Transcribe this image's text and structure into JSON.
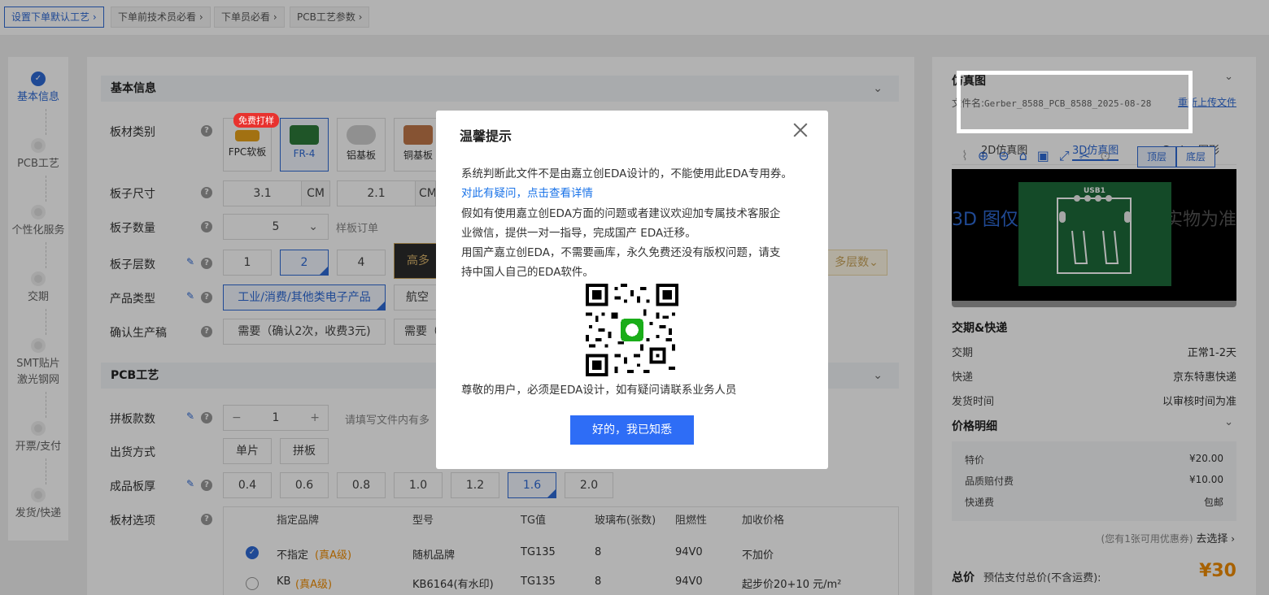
{
  "breadcrumb": [
    "设置下单默认工艺",
    "下单前技术员必看",
    "下单员必看",
    "PCB工艺参数"
  ],
  "steps": [
    "基本信息",
    "PCB工艺",
    "个性化服务",
    "交期",
    "SMT贴片激光钢网",
    "开票/支付",
    "发货/快递"
  ],
  "basic": {
    "title": "基本信息",
    "board_type_label": "板材类别",
    "free_badge": "免费打样",
    "materials": [
      "FPC软板",
      "FR-4",
      "铝基板",
      "铜基板"
    ],
    "size_label": "板子尺寸",
    "size_w": "3.1",
    "size_h": "2.1",
    "unit": "CM",
    "qty_label": "板子数量",
    "qty": "5",
    "qty_note": "样板订单",
    "layers_label": "板子层数",
    "layers": [
      "1",
      "2",
      "4"
    ],
    "layers_high": "高多",
    "layers_more": "多层数",
    "product_label": "产品类型",
    "product_sel": "工业/消费/其他类电子产品",
    "product_alt": "航空",
    "confirm_label": "确认生产稿",
    "confirm_opt1": "需要（确认2次，收费3元)",
    "confirm_opt2": "需要（"
  },
  "pcb": {
    "title": "PCB工艺",
    "panel_label": "拼板款数",
    "panel_qty": "1",
    "panel_note": "请填写文件内有多",
    "ship_label": "出货方式",
    "ship_opts": [
      "单片",
      "拼板"
    ],
    "thick_label": "成品板厚",
    "thick_opts": [
      "0.4",
      "0.6",
      "0.8",
      "1.0",
      "1.2",
      "1.6",
      "2.0"
    ],
    "material_label": "板材选项",
    "table_headers": [
      "指定品牌",
      "型号",
      "TG值",
      "玻璃布(张数)",
      "阻燃性",
      "加收价格"
    ],
    "rows": [
      {
        "brand": "不指定",
        "grade": "(真A级)",
        "model": "随机品牌",
        "tg": "TG135",
        "glass": "8",
        "flame": "94V0",
        "price": "不加价"
      },
      {
        "brand": "KB",
        "grade": "(真A级)",
        "model": "KB6164(有水印)",
        "tg": "TG135",
        "glass": "8",
        "flame": "94V0",
        "price": "起步价20+10 元/m²"
      }
    ]
  },
  "right": {
    "preview_title": "仿真图",
    "file_prefix": "文件名:",
    "file_name": "Gerber_8588_PCB_8588_2025-08-28",
    "reupload": "重新上传文件",
    "tabs": [
      "2D仿真图",
      "3D仿真图",
      "Gerber图形"
    ],
    "top_btn": "顶层",
    "bottom_btn": "底层",
    "board_label": "USB1",
    "watermark_left": "3D 图仅",
    "watermark_right": "实物为准",
    "delivery_title": "交期&快递",
    "delivery": [
      {
        "k": "交期",
        "v": "正常1-2天"
      },
      {
        "k": "快递",
        "v": "京东特惠快递"
      },
      {
        "k": "发货时间",
        "v": "以审核时间为准"
      }
    ],
    "price_title": "价格明细",
    "prices": [
      {
        "k": "特价",
        "v": "¥20.00"
      },
      {
        "k": "品质赔付费",
        "v": "¥10.00"
      },
      {
        "k": "快递费",
        "v": "包邮"
      }
    ],
    "coupon_note": "(您有1张可用优惠券)",
    "coupon_link": "去选择",
    "total_label": "总价",
    "total_note": "预估支付总价(不含运费):",
    "total": "¥30"
  },
  "modal": {
    "title": "温馨提示",
    "line1": "系统判断此文件不是由嘉立创EDA设计的，不能使用此EDA专用券。",
    "link": "对此有疑问，点击查看详情",
    "line3": "假如有使用嘉立创EDA方面的问题或者建议欢迎加专属技术客服企",
    "line4": "业微信，提供一对一指导，完成国产 EDA迁移。",
    "line5": "用国产嘉立创EDA，不需要画库，永久免费还没有版权问题，请支",
    "line6": "持中国人自己的EDA软件。",
    "footer": "尊敬的用户，必须是EDA设计，如有疑问请联系业务人员",
    "ok": "好的，我已知悉"
  },
  "colors": {
    "accent": "#2e6ad6",
    "button": "#2e6df6",
    "price": "#f08c00",
    "board_green": "#1e6b3a"
  }
}
